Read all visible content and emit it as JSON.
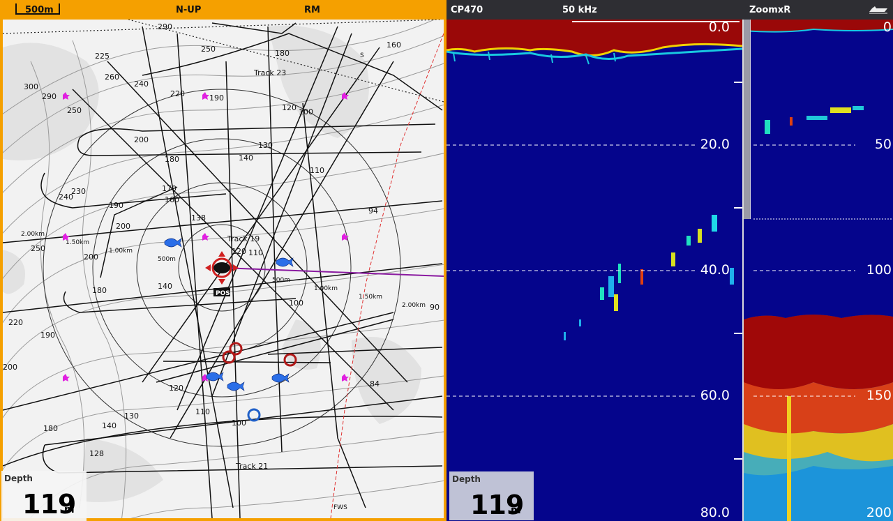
{
  "chart_header": {
    "scale": "500m",
    "orientation": "N-UP",
    "motion": "RM"
  },
  "chart_depth": {
    "label": "Depth",
    "value": "119",
    "unit": "m"
  },
  "sonar_header": {
    "model": "CP470",
    "frequency": "50 kHz",
    "mode": "ZoomxR"
  },
  "sonar_depth": {
    "label": "Depth",
    "value": "119",
    "unit": "m"
  },
  "main_scale": [
    "0.0",
    "20.0",
    "40.0",
    "60.0",
    "80.0"
  ],
  "zoom_scale": [
    "0",
    "50",
    "100",
    "150",
    "200"
  ],
  "chart": {
    "soundings": [
      "290",
      "250",
      "225",
      "260",
      "300",
      "240",
      "290",
      "250",
      "190",
      "220",
      "180",
      "160",
      "200",
      "180",
      "160",
      "170",
      "140",
      "130",
      "120",
      "100",
      "110",
      "94",
      "90",
      "84",
      "200",
      "240",
      "230",
      "190",
      "250",
      "200",
      "180",
      "140",
      "220",
      "190",
      "200",
      "120",
      "110",
      "130",
      "180",
      "140",
      "128",
      "100",
      "138",
      "120",
      "110",
      "100"
    ],
    "ring_labels": [
      "500m",
      "1.00km",
      "1.50km",
      "2.00km",
      "500m",
      "1.00km",
      "1.50km",
      "2.00km"
    ],
    "tracks": [
      "Track 23",
      "Track 19",
      "Track 21"
    ],
    "vessel_label": "POS",
    "other_labels": [
      "S",
      "FWS"
    ]
  }
}
